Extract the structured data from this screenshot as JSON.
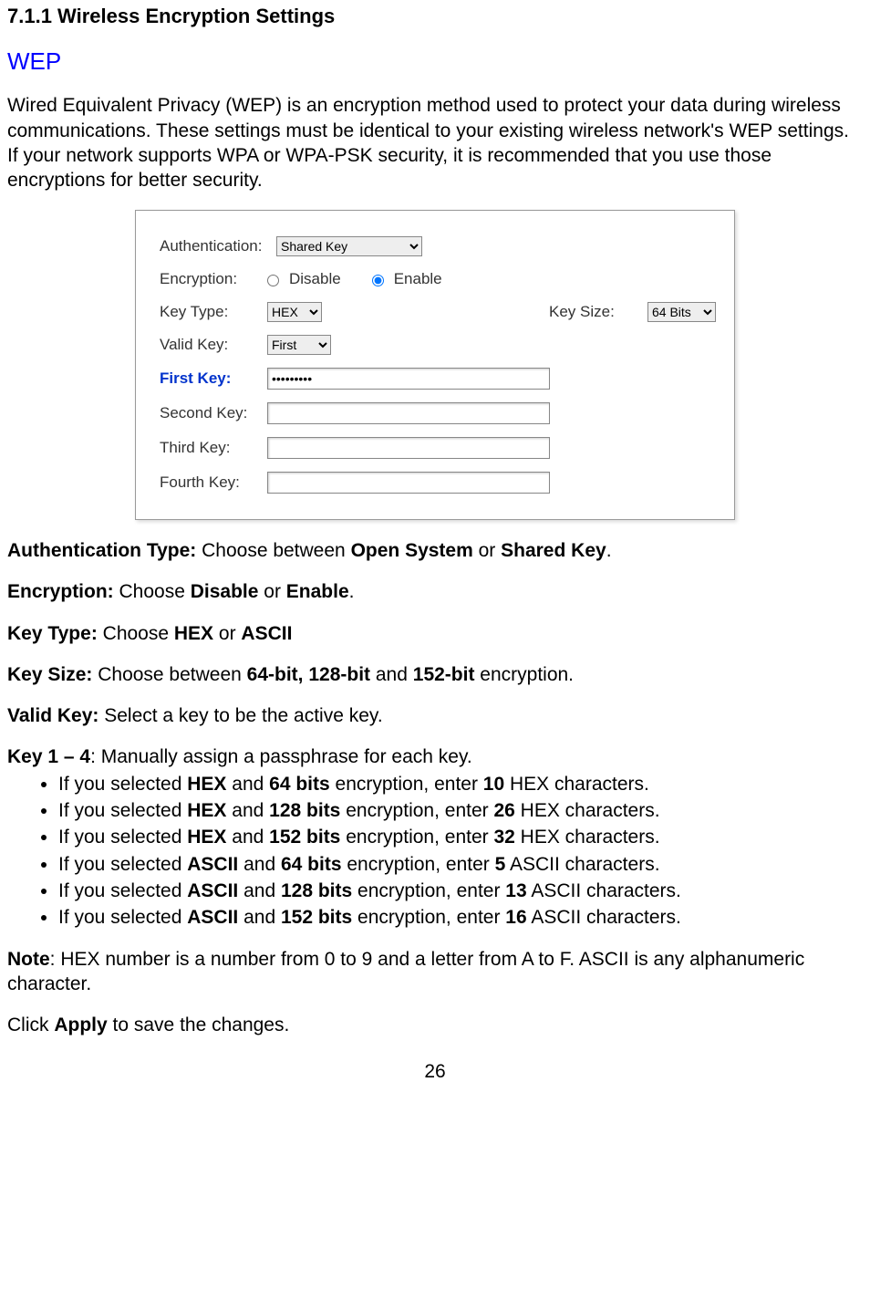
{
  "heading_section": "7.1.1 Wireless Encryption Settings",
  "heading_wep": "WEP",
  "intro": "Wired Equivalent Privacy (WEP) is an encryption method used to protect your data during wireless communications. These settings must be identical to your existing wireless network's WEP settings. If your network supports WPA or WPA-PSK security, it is recommended that you use those encryptions for better security.",
  "screenshot": {
    "auth_label": "Authentication:",
    "auth_value": "Shared Key",
    "enc_label": "Encryption:",
    "enc_disable": "Disable",
    "enc_enable": "Enable",
    "keytype_label": "Key Type:",
    "keytype_value": "HEX",
    "keysize_label": "Key Size:",
    "keysize_value": "64 Bits",
    "validkey_label": "Valid Key:",
    "validkey_value": "First",
    "firstkey_label": "First Key:",
    "firstkey_value": "•••••••••",
    "secondkey_label": "Second Key:",
    "thirdkey_label": "Third Key:",
    "fourthkey_label": "Fourth Key:"
  },
  "desc": {
    "auth_b": "Authentication Type: ",
    "auth_t1": "Choose between ",
    "auth_b2": "Open System",
    "auth_t2": " or ",
    "auth_b3": "Shared Key",
    "auth_t3": ".",
    "enc_b": "Encryption: ",
    "enc_t1": "Choose ",
    "enc_b2": "Disable",
    "enc_t2": " or ",
    "enc_b3": "Enable",
    "enc_t3": ".",
    "kt_b": "Key Type: ",
    "kt_t1": "Choose ",
    "kt_b2": "HEX",
    "kt_t2": " or ",
    "kt_b3": "ASCII",
    "ks_b": "Key Size: ",
    "ks_t1": "Choose between ",
    "ks_b2": "64-bit, 128-bit",
    "ks_t2": " and ",
    "ks_b3": "152-bit",
    "ks_t3": " encryption.",
    "vk_b": "Valid Key: ",
    "vk_t": "Select a key to be the active key.",
    "k14_b": "Key 1 – 4",
    "k14_t": ": Manually assign a passphrase for each key."
  },
  "bullets": [
    {
      "p1": "If you selected ",
      "b1": "HEX",
      "p2": " and ",
      "b2": "64 bits",
      "p3": " encryption, enter ",
      "b3": "10",
      "p4": " HEX characters."
    },
    {
      "p1": "If you selected ",
      "b1": "HEX",
      "p2": " and ",
      "b2": "128 bits",
      "p3": " encryption, enter ",
      "b3": "26",
      "p4": " HEX characters."
    },
    {
      "p1": "If you selected ",
      "b1": "HEX",
      "p2": " and ",
      "b2": "152 bits",
      "p3": " encryption, enter ",
      "b3": "32",
      "p4": " HEX characters."
    },
    {
      "p1": "If you selected ",
      "b1": "ASCII",
      "p2": " and ",
      "b2": "64 bits",
      "p3": " encryption, enter ",
      "b3": "5",
      "p4": " ASCII characters."
    },
    {
      "p1": "If you selected ",
      "b1": "ASCII",
      "p2": " and ",
      "b2": "128 bits",
      "p3": " encryption, enter ",
      "b3": "13",
      "p4": " ASCII characters."
    },
    {
      "p1": "If you selected ",
      "b1": "ASCII",
      "p2": " and ",
      "b2": "152 bits",
      "p3": " encryption, enter ",
      "b3": "16",
      "p4": " ASCII characters."
    }
  ],
  "note_b": "Note",
  "note_t": ": HEX number is a number from 0 to 9 and a letter from A to F. ASCII is any alphanumeric character.",
  "apply_p1": "Click ",
  "apply_b": "Apply",
  "apply_p2": " to save the changes.",
  "page_number": "26"
}
